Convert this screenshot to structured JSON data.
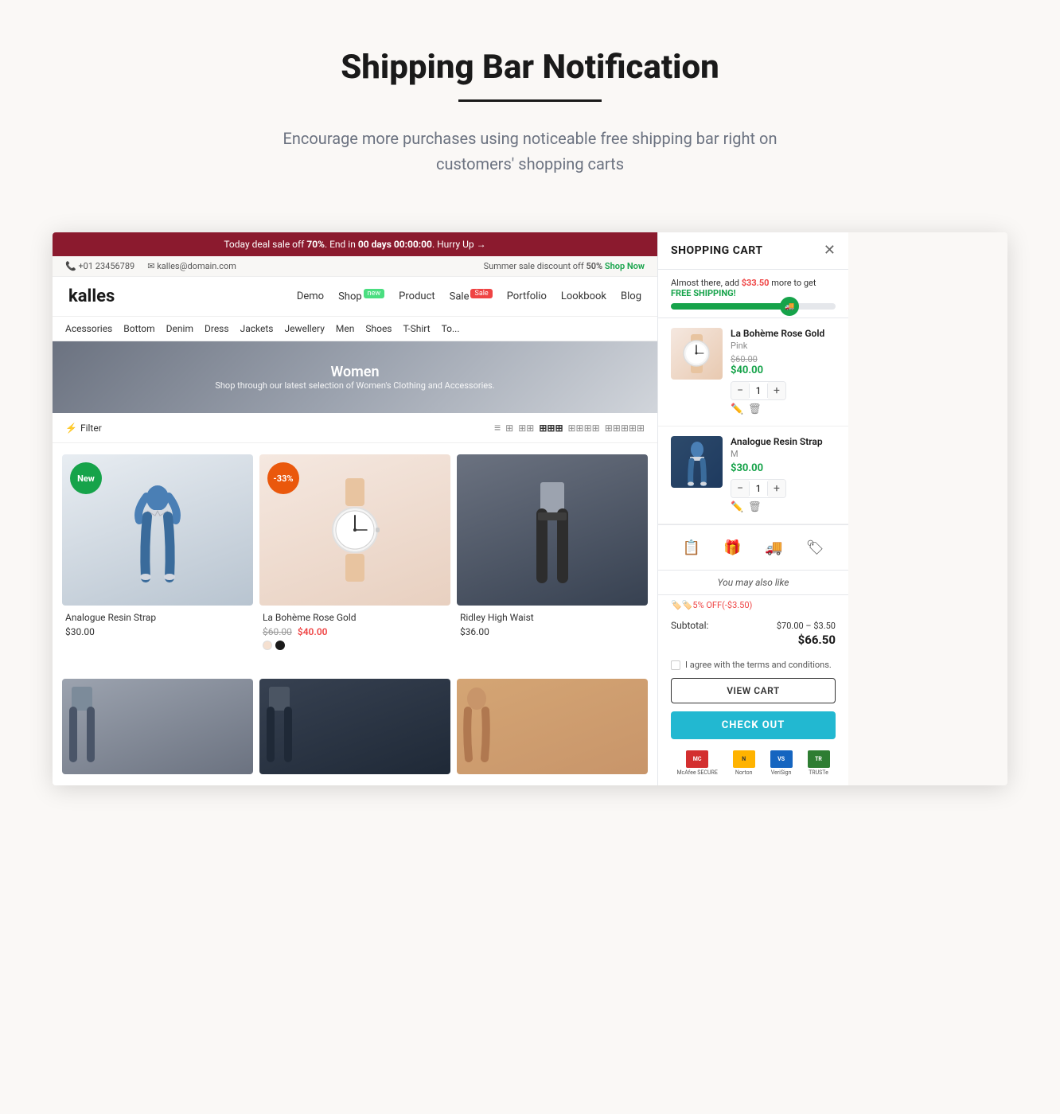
{
  "page": {
    "title": "Shipping Bar Notification",
    "underline": true,
    "subtitle": "Encourage more purchases using noticeable free shipping bar right on customers' shopping carts"
  },
  "shop": {
    "announcement": {
      "text": "Today deal sale off ",
      "percent": "70%",
      "end_text": ". End in ",
      "countdown": "00 days 00:00:00",
      "cta": ". Hurry Up →"
    },
    "contacts": {
      "phone": "+01 23456789",
      "email": "kalles@domain.com",
      "sale_text": "Summer sale discount off ",
      "sale_percent": "50%",
      "shop_now": "Shop Now"
    },
    "nav": {
      "logo": "kalles",
      "links": [
        "Demo",
        "Shop",
        "Product",
        "Sale",
        "Portfolio",
        "Lookbook",
        "Blog"
      ],
      "badges": {
        "Shop": "new",
        "Sale": "sale"
      }
    },
    "categories": [
      "Acessories",
      "Bottom",
      "Denim",
      "Dress",
      "Jackets",
      "Jewellery",
      "Men",
      "Shoes",
      "T-Shirt",
      "To..."
    ],
    "hero": {
      "title": "Women",
      "subtitle": "Shop through our latest selection of Women's Clothing and Accessories."
    },
    "products": [
      {
        "name": "Analogue Resin Strap",
        "price": "$30.00",
        "badge": "New",
        "badge_type": "new",
        "img_class": "img-jogger"
      },
      {
        "name": "La Bohème Rose Gold",
        "price_old": "$60.00",
        "price_new": "$40.00",
        "badge": "-33%",
        "badge_type": "sale",
        "img_class": "img-watch",
        "colors": [
          "#f5e8e0",
          "#1a1a1a"
        ]
      },
      {
        "name": "Ridley High Waist",
        "price": "$36.00",
        "img_class": "img-black-pants"
      }
    ],
    "products_row2": [
      {
        "img_class": "img-dark1"
      },
      {
        "img_class": "img-dark2"
      },
      {
        "img_class": "img-curly"
      }
    ]
  },
  "cart": {
    "title": "SHOPPING CART",
    "shipping_bar": {
      "text": "Almost there, add ",
      "amount": "$33.50",
      "suffix": " more to get ",
      "cta": "FREE SHIPPING!",
      "progress": 75
    },
    "items": [
      {
        "name": "La Bohème Rose Gold",
        "variant": "Pink",
        "price_old": "$60.00",
        "price": "$40.00",
        "qty": 1,
        "img_type": "watch"
      },
      {
        "name": "Analogue Resin Strap",
        "variant": "M",
        "price": "$30.00",
        "qty": 1,
        "img_type": "jogger"
      }
    ],
    "icons": [
      "clipboard",
      "gift",
      "truck",
      "tag"
    ],
    "also_like": "You may also like",
    "discount": "🏷️5% OFF(-$3.50)",
    "subtotal_label": "Subtotal:",
    "subtotal_calc": "$70.00 – $3.50",
    "subtotal_total": "$66.50",
    "terms": "I agree with the terms and conditions.",
    "view_cart": "VIEW CART",
    "checkout": "CHECK OUT",
    "badges": [
      {
        "name": "McAfee SECURE",
        "color": "#d32f2f"
      },
      {
        "name": "Norton",
        "color": "#ffb300"
      },
      {
        "name": "VeriSign",
        "color": "#1565c0"
      },
      {
        "name": "TRUSTe",
        "color": "#2e7d32"
      }
    ]
  }
}
